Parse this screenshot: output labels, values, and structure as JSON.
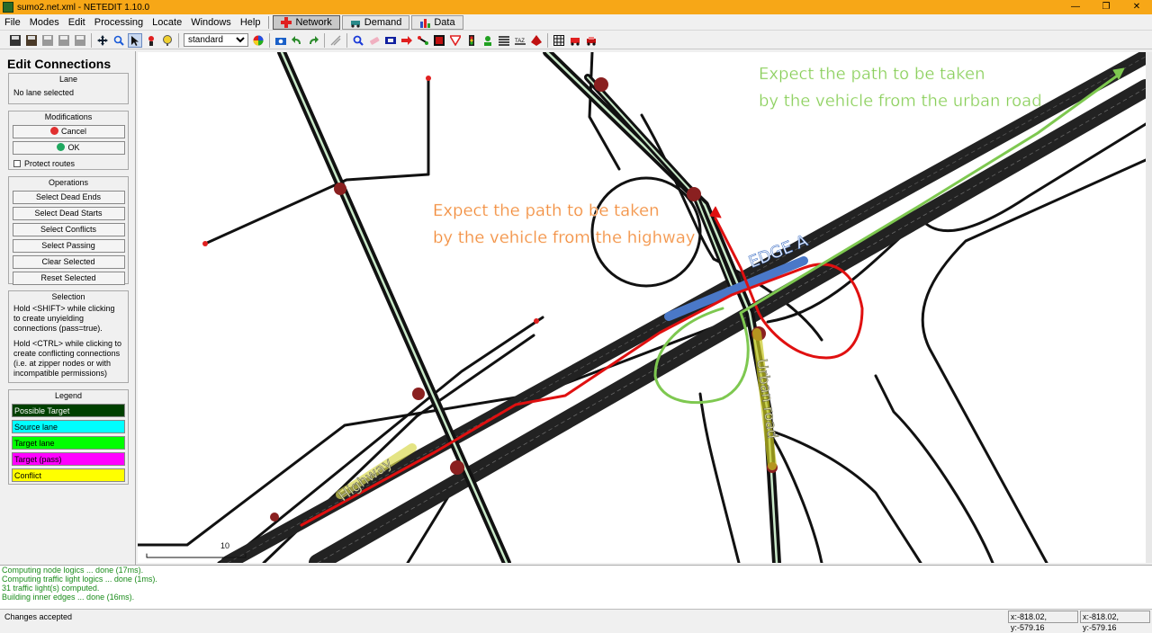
{
  "window": {
    "title": "sumo2.net.xml - NETEDIT 1.10.0",
    "min": "—",
    "max": "❐",
    "close": "✕"
  },
  "menus": [
    "File",
    "Modes",
    "Edit",
    "Processing",
    "Locate",
    "Windows",
    "Help"
  ],
  "supermodes": {
    "network": "Network",
    "demand": "Demand",
    "data": "Data"
  },
  "toolbar": {
    "viewscheme": "standard",
    "icons": [
      "save-net-icon",
      "save-all-icon",
      "save-additionals-icon",
      "save-demand-icon",
      "save-data-icon",
      "move-icon",
      "zoom-icon",
      "select-icon",
      "inspect-icon",
      "locate-icon",
      "color-wheel-icon",
      "screenshot-icon",
      "undo-icon",
      "redo-icon",
      "crossing-icon",
      "inspect-mode-icon",
      "delete-icon",
      "select-mode-icon",
      "move-mode-icon",
      "create-edge-icon",
      "connection-icon",
      "traffic-light-icon",
      "additional-icon",
      "crossing-mode-icon",
      "taz-icon",
      "polygon-icon",
      "grid-icon",
      "vehicle-icon",
      "car-icon"
    ]
  },
  "panel": {
    "title": "Edit Connections",
    "lane": {
      "title": "Lane",
      "text": "No lane selected"
    },
    "modifications": {
      "title": "Modifications",
      "cancel": "Cancel",
      "ok": "OK",
      "protect": "Protect routes"
    },
    "operations": {
      "title": "Operations",
      "buttons": [
        "Select Dead Ends",
        "Select Dead Starts",
        "Select Conflicts",
        "Select Passing",
        "Clear Selected",
        "Reset Selected"
      ]
    },
    "selection": {
      "title": "Selection",
      "text1": "Hold <SHIFT> while clicking to create unyielding connections (pass=true).",
      "text2": "Hold <CTRL> while clicking to create conflicting connections (i.e. at zipper nodes or with incompatible permissions)"
    },
    "legend": {
      "title": "Legend",
      "items": [
        {
          "label": "Possible Target",
          "color": "#004000",
          "text": "#ffffff"
        },
        {
          "label": "Source lane",
          "color": "#00ffff",
          "text": "#000000"
        },
        {
          "label": "Target lane",
          "color": "#00ff00",
          "text": "#000000"
        },
        {
          "label": "Target (pass)",
          "color": "#ff00ff",
          "text": "#000000"
        },
        {
          "label": "Conflict",
          "color": "#ffff00",
          "text": "#000000"
        }
      ]
    }
  },
  "annotations": {
    "green_line1": "Expect the path to be taken",
    "green_line2": "by the vehicle from the urban road",
    "red_line1": "Expect the path to be taken",
    "red_line2": "by the vehicle from the highway",
    "edge_a": "EDGE A",
    "urban": "Urban road",
    "highway": "Highway",
    "scale": "10"
  },
  "messages": [
    "Computing node logics ... done (17ms).",
    "Computing traffic light logics ... done (1ms).",
    " 31 traffic light(s) computed.",
    "Building inner edges ... done (16ms)."
  ],
  "status": {
    "text": "Changes accepted",
    "coord1": "x:-818.02, y:-579.16",
    "coord2": "x:-818.02, y:-579.16"
  },
  "colors": {
    "titlebar": "#f7a717",
    "route_green": "#7ec850",
    "route_red": "#e01010",
    "edge_highlight": "#4a78c8"
  }
}
